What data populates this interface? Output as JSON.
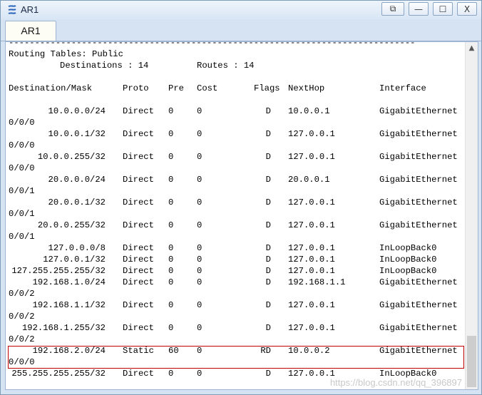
{
  "window": {
    "title": "AR1",
    "controls": {
      "restore": "⧉",
      "minimize": "—",
      "maximize": "☐",
      "close": "X"
    }
  },
  "tabs": [
    {
      "label": "AR1"
    }
  ],
  "console": {
    "separator": "------------------------------------------------------------------------------",
    "header1": "Routing Tables: Public",
    "header2": {
      "destinations": "Destinations : 14",
      "routes": "Routes : 14"
    },
    "columns": [
      "Destination/Mask",
      "Proto",
      "Pre",
      "Cost",
      "Flags",
      "NextHop",
      "Interface"
    ],
    "rows": [
      {
        "dest": "10.0.0.0/24",
        "proto": "Direct",
        "pre": "0",
        "cost": "0",
        "flags": "D",
        "nexthop": "10.0.0.1",
        "iface": "GigabitEthernet",
        "cont": "0/0/0"
      },
      {
        "dest": "10.0.0.1/32",
        "proto": "Direct",
        "pre": "0",
        "cost": "0",
        "flags": "D",
        "nexthop": "127.0.0.1",
        "iface": "GigabitEthernet",
        "cont": "0/0/0"
      },
      {
        "dest": "10.0.0.255/32",
        "proto": "Direct",
        "pre": "0",
        "cost": "0",
        "flags": "D",
        "nexthop": "127.0.0.1",
        "iface": "GigabitEthernet",
        "cont": "0/0/0"
      },
      {
        "dest": "20.0.0.0/24",
        "proto": "Direct",
        "pre": "0",
        "cost": "0",
        "flags": "D",
        "nexthop": "20.0.0.1",
        "iface": "GigabitEthernet",
        "cont": "0/0/1"
      },
      {
        "dest": "20.0.0.1/32",
        "proto": "Direct",
        "pre": "0",
        "cost": "0",
        "flags": "D",
        "nexthop": "127.0.0.1",
        "iface": "GigabitEthernet",
        "cont": "0/0/1"
      },
      {
        "dest": "20.0.0.255/32",
        "proto": "Direct",
        "pre": "0",
        "cost": "0",
        "flags": "D",
        "nexthop": "127.0.0.1",
        "iface": "GigabitEthernet",
        "cont": "0/0/1"
      },
      {
        "dest": "127.0.0.0/8",
        "proto": "Direct",
        "pre": "0",
        "cost": "0",
        "flags": "D",
        "nexthop": "127.0.0.1",
        "iface": "InLoopBack0",
        "cont": ""
      },
      {
        "dest": "127.0.0.1/32",
        "proto": "Direct",
        "pre": "0",
        "cost": "0",
        "flags": "D",
        "nexthop": "127.0.0.1",
        "iface": "InLoopBack0",
        "cont": ""
      },
      {
        "dest": "127.255.255.255/32",
        "proto": "Direct",
        "pre": "0",
        "cost": "0",
        "flags": "D",
        "nexthop": "127.0.0.1",
        "iface": "InLoopBack0",
        "cont": ""
      },
      {
        "dest": "192.168.1.0/24",
        "proto": "Direct",
        "pre": "0",
        "cost": "0",
        "flags": "D",
        "nexthop": "192.168.1.1",
        "iface": "GigabitEthernet",
        "cont": "0/0/2"
      },
      {
        "dest": "192.168.1.1/32",
        "proto": "Direct",
        "pre": "0",
        "cost": "0",
        "flags": "D",
        "nexthop": "127.0.0.1",
        "iface": "GigabitEthernet",
        "cont": "0/0/2"
      },
      {
        "dest": "192.168.1.255/32",
        "proto": "Direct",
        "pre": "0",
        "cost": "0",
        "flags": "D",
        "nexthop": "127.0.0.1",
        "iface": "GigabitEthernet",
        "cont": "0/0/2"
      },
      {
        "dest": "192.168.2.0/24",
        "proto": "Static",
        "pre": "60",
        "cost": "0",
        "flags": "RD",
        "nexthop": "10.0.0.2",
        "iface": "GigabitEthernet",
        "cont": "0/0/0",
        "highlighted": true
      },
      {
        "dest": "255.255.255.255/32",
        "proto": "Direct",
        "pre": "0",
        "cost": "0",
        "flags": "D",
        "nexthop": "127.0.0.1",
        "iface": "InLoopBack0",
        "cont": ""
      }
    ]
  },
  "watermark": "https://blog.csdn.net/qq_396897",
  "colors": {
    "highlight_border": "#c00000",
    "titlebar": "#d9e6f5"
  }
}
